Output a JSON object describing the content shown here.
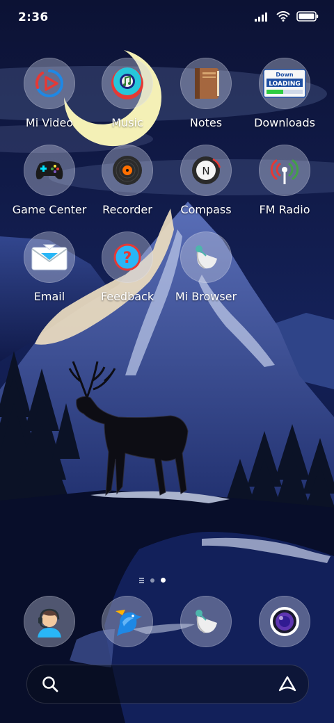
{
  "status": {
    "time": "2:36"
  },
  "apps": [
    {
      "label": "Mi Video"
    },
    {
      "label": "Music"
    },
    {
      "label": "Notes"
    },
    {
      "label": "Downloads",
      "badge_text": [
        "Down",
        "LOADING"
      ]
    },
    {
      "label": "Game Center"
    },
    {
      "label": "Recorder"
    },
    {
      "label": "Compass",
      "dial_letter": "N"
    },
    {
      "label": "FM Radio"
    },
    {
      "label": "Email"
    },
    {
      "label": "Feedback",
      "glyph": "?"
    },
    {
      "label": "Mi Browser"
    }
  ],
  "dock": [
    {
      "icon": "support-agent-icon"
    },
    {
      "icon": "bird-icon"
    },
    {
      "icon": "browser-icon"
    },
    {
      "icon": "camera-lens-icon"
    }
  ],
  "pager": {
    "pages": 3,
    "current_page": 3
  },
  "colors": {
    "sky": "#0c1438",
    "mountain": "#3a5197",
    "snow": "#e9dbc0",
    "moon": "#f4f0b6"
  }
}
